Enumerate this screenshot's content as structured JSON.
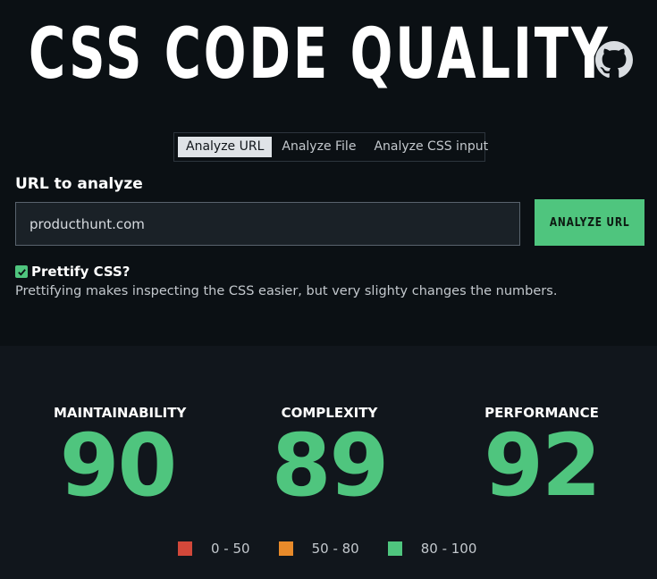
{
  "header": {
    "title": "CSS CODE QUALITY",
    "github_icon": "github-icon"
  },
  "tabs": [
    {
      "label": "Analyze URL",
      "active": true
    },
    {
      "label": "Analyze File",
      "active": false
    },
    {
      "label": "Analyze CSS input",
      "active": false
    }
  ],
  "form": {
    "url_label": "URL to analyze",
    "url_value": "producthunt.com",
    "button_label": "ANALYZE URL",
    "prettify_label": "Prettify CSS?",
    "prettify_checked": true,
    "prettify_help": "Prettifying makes inspecting the CSS easier, but very slighty changes the numbers."
  },
  "scores": [
    {
      "label": "MAINTAINABILITY",
      "value": "90"
    },
    {
      "label": "COMPLEXITY",
      "value": "89"
    },
    {
      "label": "PERFORMANCE",
      "value": "92"
    }
  ],
  "legend": [
    {
      "range": "0 - 50",
      "color": "#d2483a"
    },
    {
      "range": "50 - 80",
      "color": "#e88a2a"
    },
    {
      "range": "80 - 100",
      "color": "#4fc57e"
    }
  ],
  "colors": {
    "accent": "#4fc57e",
    "background": "#0b1014",
    "panel": "#11161c"
  }
}
